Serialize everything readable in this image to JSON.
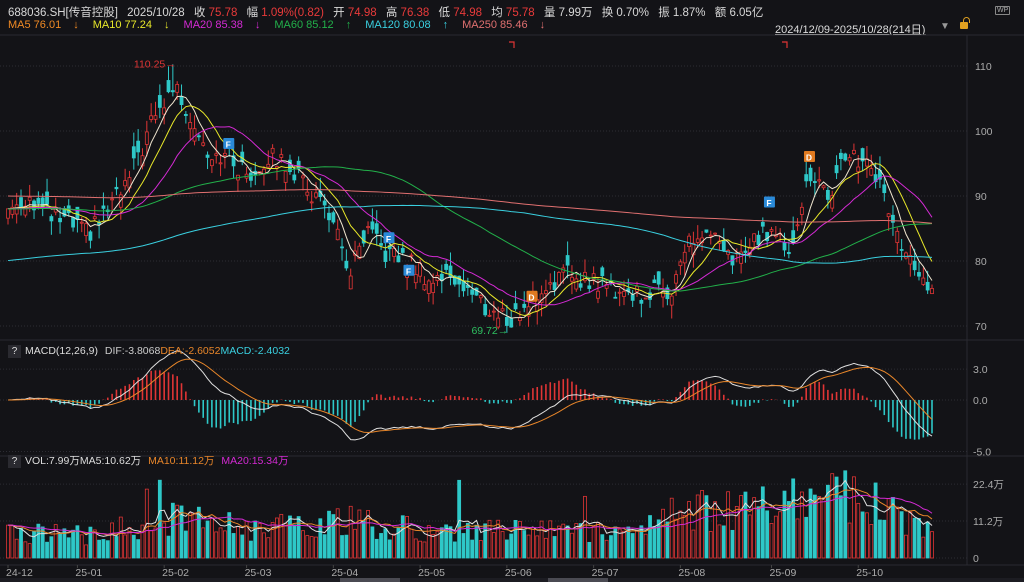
{
  "header": {
    "symbol": "688036.SH[传音控股]",
    "date": "2025/10/28",
    "close_label": "收",
    "close": "75.78",
    "change_label": "幅",
    "change": "1.09%(0.82)",
    "open_label": "开",
    "open": "74.98",
    "high_label": "高",
    "high": "76.38",
    "low_label": "低",
    "low": "74.98",
    "avg_label": "均",
    "avg": "75.78",
    "volume_label": "量",
    "volume": "7.99万",
    "turnover_label": "换",
    "turnover": "0.70%",
    "amplitude_label": "振",
    "amplitude": "1.87%",
    "amount_label": "额",
    "amount": "6.05亿",
    "range": "2024/12/09-2025/10/28(214日)",
    "wp_icon": "WP"
  },
  "ma_legend": [
    {
      "text": "MA5 76.01",
      "arrow": "↓",
      "color": "#f08a24"
    },
    {
      "text": "MA10 77.24",
      "arrow": "↓",
      "color": "#e8e82a"
    },
    {
      "text": "MA20 85.38",
      "arrow": "↓",
      "color": "#d42ad4"
    },
    {
      "text": "MA60 85.12",
      "arrow": "↑",
      "color": "#22b04a"
    },
    {
      "text": "MA120 80.08",
      "arrow": "↑",
      "color": "#3ad0e0"
    },
    {
      "text": "MA250 85.46",
      "arrow": "↓",
      "color": "#e07070"
    }
  ],
  "macd_legend": {
    "help": "?",
    "name": "MACD(12,26,9)",
    "dif": "DIF:-3.8068",
    "dea": "DEA:-2.6052",
    "macd": "MACD:-2.4032"
  },
  "vol_legend": {
    "help": "?",
    "vol": "VOL:7.99万",
    "ma5": "MA5:10.62万",
    "ma10": "MA10:11.12万",
    "ma20": "MA20:15.34万"
  },
  "colors": {
    "up": "#e03535",
    "down": "#2ec8c8",
    "background": "#131317",
    "dif": "#e0e0e0",
    "dea": "#e8862a",
    "vol_ma5": "#e0e0e0",
    "vol_ma10": "#e8862a",
    "vol_ma20": "#d42ad4"
  },
  "chart_data": {
    "type": "candlestick",
    "start_date": "2024-12-09",
    "end_date": "2025-10-28",
    "trading_days": 214,
    "price_axis": {
      "ticks": [
        70,
        80,
        90,
        100,
        110
      ],
      "range": [
        67,
        115
      ]
    },
    "macd_axis": {
      "ticks": [
        "3.0",
        "0.0",
        "-5.0"
      ],
      "values": [
        3,
        0,
        -5
      ]
    },
    "volume_axis": {
      "ticks": [
        "22.4万",
        "11.2万",
        "0"
      ],
      "values": [
        22.4,
        11.2,
        0
      ]
    },
    "x_labels": [
      "24-12",
      "25-01",
      "25-02",
      "25-03",
      "25-04",
      "25-05",
      "25-06",
      "25-07",
      "25-08",
      "25-09",
      "25-10"
    ],
    "close_path": [
      [
        "2024-12-09",
        88
      ],
      [
        "2024-12-16",
        90
      ],
      [
        "2024-12-23",
        87
      ],
      [
        "2024-12-30",
        86
      ],
      [
        "2025-01-06",
        84
      ],
      [
        "2025-01-13",
        88
      ],
      [
        "2025-01-20",
        92
      ],
      [
        "2025-01-27",
        100
      ],
      [
        "2025-02-05",
        107
      ],
      [
        "2025-02-10",
        103
      ],
      [
        "2025-02-17",
        97
      ],
      [
        "2025-02-24",
        96
      ],
      [
        "2025-03-03",
        93
      ],
      [
        "2025-03-10",
        96
      ],
      [
        "2025-03-17",
        95
      ],
      [
        "2025-03-24",
        91
      ],
      [
        "2025-03-31",
        88
      ],
      [
        "2025-04-07",
        78
      ],
      [
        "2025-04-14",
        84
      ],
      [
        "2025-04-21",
        81
      ],
      [
        "2025-04-28",
        80
      ],
      [
        "2025-05-06",
        77
      ],
      [
        "2025-05-13",
        78
      ],
      [
        "2025-05-20",
        75
      ],
      [
        "2025-05-27",
        72
      ],
      [
        "2025-06-03",
        71
      ],
      [
        "2025-06-10",
        74
      ],
      [
        "2025-06-17",
        77
      ],
      [
        "2025-06-24",
        78
      ],
      [
        "2025-07-01",
        77
      ],
      [
        "2025-07-08",
        76
      ],
      [
        "2025-07-15",
        75
      ],
      [
        "2025-07-22",
        75
      ],
      [
        "2025-07-29",
        76
      ],
      [
        "2025-08-04",
        83
      ],
      [
        "2025-08-11",
        84
      ],
      [
        "2025-08-18",
        80
      ],
      [
        "2025-08-25",
        82
      ],
      [
        "2025-09-01",
        85
      ],
      [
        "2025-09-08",
        82
      ],
      [
        "2025-09-15",
        93
      ],
      [
        "2025-09-22",
        90
      ],
      [
        "2025-09-29",
        97
      ],
      [
        "2025-10-09",
        93
      ],
      [
        "2025-10-16",
        84
      ],
      [
        "2025-10-23",
        77
      ],
      [
        "2025-10-28",
        75.78
      ]
    ],
    "volume_path_wan": [
      [
        "2024-12-09",
        8
      ],
      [
        "2025-01-06",
        7
      ],
      [
        "2025-02-05",
        12
      ],
      [
        "2025-03-03",
        9
      ],
      [
        "2025-04-07",
        11
      ],
      [
        "2025-05-06",
        8
      ],
      [
        "2025-06-03",
        9
      ],
      [
        "2025-07-01",
        7
      ],
      [
        "2025-08-04",
        14
      ],
      [
        "2025-09-01",
        15
      ],
      [
        "2025-09-22",
        20
      ],
      [
        "2025-10-09",
        16
      ],
      [
        "2025-10-28",
        7.99
      ]
    ],
    "last_candle": {
      "open": 74.98,
      "high": 76.38,
      "low": 74.98,
      "close": 75.78,
      "volume_wan": 7.99
    },
    "annotations": [
      {
        "text": "110.25",
        "date": "2025-02-05",
        "value": 110.25,
        "color": "#e03535"
      },
      {
        "text": "69.72",
        "date": "2025-06-03",
        "value": 69.72,
        "color": "#2ec060"
      }
    ],
    "markers": [
      {
        "text": "F",
        "date": "2025-02-24",
        "value": 98,
        "color": "#2a8ad8"
      },
      {
        "text": "F",
        "date": "2025-04-21",
        "value": 83.5,
        "color": "#2a8ad8"
      },
      {
        "text": "F",
        "date": "2025-04-28",
        "value": 78.5,
        "color": "#2a8ad8"
      },
      {
        "text": "D",
        "date": "2025-06-10",
        "value": 74.5,
        "color": "#e07a20"
      },
      {
        "text": "F",
        "date": "2025-09-01",
        "value": 89,
        "color": "#2a8ad8"
      },
      {
        "text": "D",
        "date": "2025-09-15",
        "value": 96,
        "color": "#e07a20"
      }
    ]
  }
}
